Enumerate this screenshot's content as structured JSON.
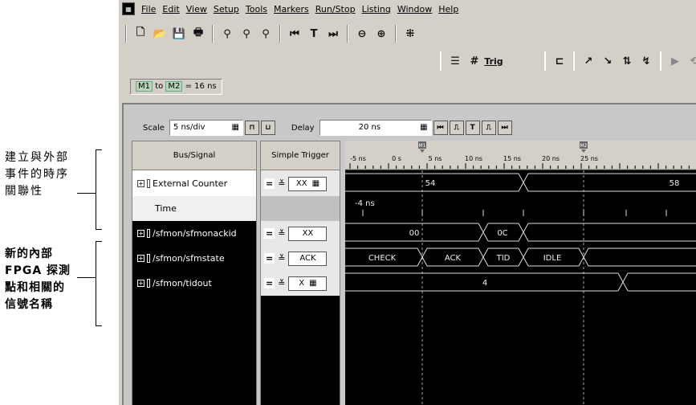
{
  "annotations": {
    "note1": "建立與外部\n事件的時序\n關聯性",
    "note2": "新的內部\nFPGA 探測\n點和相關的\n信號名稱"
  },
  "menu": [
    "File",
    "Edit",
    "View",
    "Setup",
    "Tools",
    "Markers",
    "Run/Stop",
    "Listing",
    "Window",
    "Help"
  ],
  "marker_bar": {
    "m1": "M1",
    "to": "to",
    "m2": "M2",
    "value": "= 16 ns"
  },
  "controls": {
    "scale_label": "Scale",
    "scale_value": "5 ns/div",
    "delay_label": "Delay",
    "delay_value": "20 ns"
  },
  "columns": {
    "signal_header": "Bus/Signal",
    "trigger_header": "Simple Trigger"
  },
  "signals": [
    {
      "name": "External Counter",
      "trigger": "XX"
    },
    {
      "name": "Time",
      "trigger": ""
    },
    {
      "name": "/sfmon/sfmonackid",
      "trigger": "XX"
    },
    {
      "name": "/sfmon/sfmstate",
      "trigger": "ACK"
    },
    {
      "name": "/sfmon/tidout",
      "trigger": "X"
    }
  ],
  "trigger_operator": "=",
  "time_axis": {
    "ticks": [
      "-5 ns",
      "0 s",
      "5 ns",
      "10 ns",
      "15 ns",
      "20 ns",
      "25 ns"
    ],
    "m1_label": "M1",
    "m2_label": "M2"
  },
  "waveforms": {
    "ext_counter": [
      "54",
      "58"
    ],
    "time_label": "-4 ns",
    "ackid": [
      "00",
      "0C"
    ],
    "state": [
      "CHECK",
      "ACK",
      "TID",
      "IDLE"
    ],
    "tidout": [
      "4"
    ]
  }
}
